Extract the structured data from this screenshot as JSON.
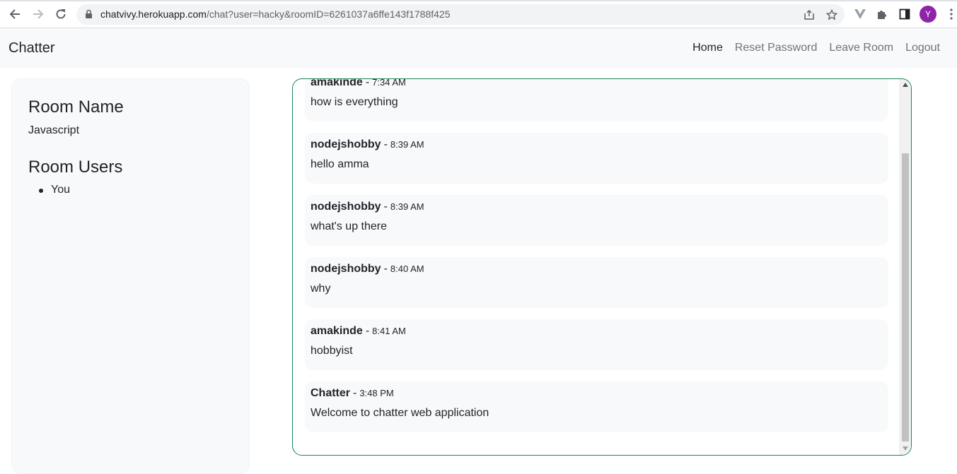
{
  "browser": {
    "url_host": "chatvivy.herokuapp.com",
    "url_path": "/chat?user=hacky&roomID=6261037a6ffe143f1788f425",
    "avatar_letter": "Y"
  },
  "navbar": {
    "brand": "Chatter",
    "links": [
      {
        "label": "Home"
      },
      {
        "label": "Reset Password"
      },
      {
        "label": "Leave Room"
      },
      {
        "label": "Logout"
      }
    ]
  },
  "sidebar": {
    "room_name_heading": "Room Name",
    "room_name": "Javascript",
    "room_users_heading": "Room Users",
    "users": [
      "You"
    ]
  },
  "chat": {
    "messages": [
      {
        "user": "amakinde",
        "sep": "-",
        "time": "7:34 AM",
        "text": "how is everything"
      },
      {
        "user": "nodejshobby",
        "sep": "-",
        "time": "8:39 AM",
        "text": "hello amma"
      },
      {
        "user": "nodejshobby",
        "sep": "-",
        "time": "8:39 AM",
        "text": "what's up there"
      },
      {
        "user": "nodejshobby",
        "sep": "-",
        "time": "8:40 AM",
        "text": "why"
      },
      {
        "user": "amakinde",
        "sep": "-",
        "time": "8:41 AM",
        "text": "hobbyist"
      },
      {
        "user": "Chatter",
        "sep": "-",
        "time": "3:48 PM",
        "text": "Welcome to chatter web application"
      }
    ]
  },
  "colors": {
    "chat_border": "#198754",
    "avatar": "#8e24aa"
  }
}
